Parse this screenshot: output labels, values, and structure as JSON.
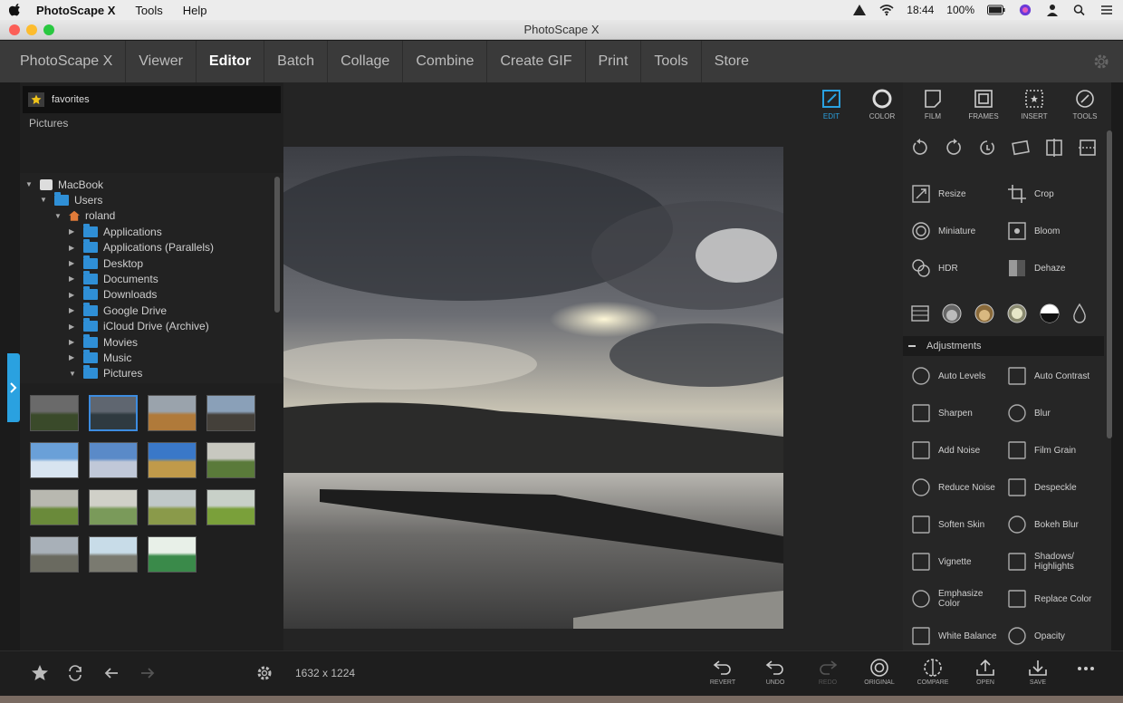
{
  "menubar": {
    "app": "PhotoScape X",
    "menus": [
      "Tools",
      "Help"
    ],
    "time": "18:44",
    "battery": "100%"
  },
  "window": {
    "title": "PhotoScape X"
  },
  "nav": {
    "tabs": [
      "PhotoScape X",
      "Viewer",
      "Editor",
      "Batch",
      "Collage",
      "Combine",
      "Create GIF",
      "Print",
      "Tools",
      "Store"
    ],
    "active": "Editor"
  },
  "browser": {
    "favorites": "favorites",
    "pictures": "Pictures",
    "tree": [
      {
        "label": "MacBook",
        "level": 0,
        "expanded": true,
        "icon": "drive-icon"
      },
      {
        "label": "Users",
        "level": 1,
        "expanded": true,
        "icon": "folder-icon"
      },
      {
        "label": "roland",
        "level": 2,
        "expanded": true,
        "icon": "home-icon"
      },
      {
        "label": "Applications",
        "level": 3,
        "expanded": false,
        "icon": "folder-icon"
      },
      {
        "label": "Applications (Parallels)",
        "level": 3,
        "expanded": false,
        "icon": "folder-icon"
      },
      {
        "label": "Desktop",
        "level": 3,
        "expanded": false,
        "icon": "folder-icon"
      },
      {
        "label": "Documents",
        "level": 3,
        "expanded": false,
        "icon": "folder-icon"
      },
      {
        "label": "Downloads",
        "level": 3,
        "expanded": false,
        "icon": "folder-icon"
      },
      {
        "label": "Google Drive",
        "level": 3,
        "expanded": false,
        "icon": "folder-icon"
      },
      {
        "label": "iCloud Drive (Archive)",
        "level": 3,
        "expanded": false,
        "icon": "folder-icon"
      },
      {
        "label": "Movies",
        "level": 3,
        "expanded": false,
        "icon": "folder-icon"
      },
      {
        "label": "Music",
        "level": 3,
        "expanded": false,
        "icon": "folder-icon"
      },
      {
        "label": "Pictures",
        "level": 3,
        "expanded": true,
        "icon": "folder-icon"
      }
    ],
    "thumbnail_count": 15,
    "selected_thumbnail": 1
  },
  "tools": {
    "top": [
      "EDIT",
      "COLOR",
      "FILM",
      "FRAMES",
      "INSERT",
      "TOOLS"
    ],
    "active": "EDIT",
    "buttons": [
      {
        "label": "Resize",
        "icon": "resize-icon"
      },
      {
        "label": "Crop",
        "icon": "crop-icon"
      },
      {
        "label": "Miniature",
        "icon": "miniature-icon"
      },
      {
        "label": "Bloom",
        "icon": "bloom-icon"
      },
      {
        "label": "HDR",
        "icon": "hdr-icon"
      },
      {
        "label": "Dehaze",
        "icon": "dehaze-icon"
      }
    ],
    "adjustments_label": "Adjustments",
    "adjustments": [
      {
        "label": "Auto Levels",
        "icon": "auto-levels-icon"
      },
      {
        "label": "Auto Contrast",
        "icon": "auto-contrast-icon"
      },
      {
        "label": "Sharpen",
        "icon": "sharpen-icon"
      },
      {
        "label": "Blur",
        "icon": "blur-icon"
      },
      {
        "label": "Add Noise",
        "icon": "add-noise-icon"
      },
      {
        "label": "Film Grain",
        "icon": "film-grain-icon"
      },
      {
        "label": "Reduce Noise",
        "icon": "reduce-noise-icon"
      },
      {
        "label": "Despeckle",
        "icon": "despeckle-icon"
      },
      {
        "label": "Soften Skin",
        "icon": "soften-skin-icon"
      },
      {
        "label": "Bokeh Blur",
        "icon": "bokeh-blur-icon"
      },
      {
        "label": "Vignette",
        "icon": "vignette-icon"
      },
      {
        "label": "Shadows/ Highlights",
        "icon": "shadows-highlights-icon"
      },
      {
        "label": "Emphasize Color",
        "icon": "emphasize-color-icon"
      },
      {
        "label": "Replace Color",
        "icon": "replace-color-icon"
      },
      {
        "label": "White Balance",
        "icon": "white-balance-icon"
      },
      {
        "label": "Opacity",
        "icon": "opacity-icon"
      }
    ]
  },
  "bottom": {
    "dimensions": "1632 x 1224",
    "actions": [
      "REVERT",
      "UNDO",
      "REDO",
      "ORIGINAL",
      "COMPARE",
      "OPEN",
      "SAVE"
    ]
  }
}
